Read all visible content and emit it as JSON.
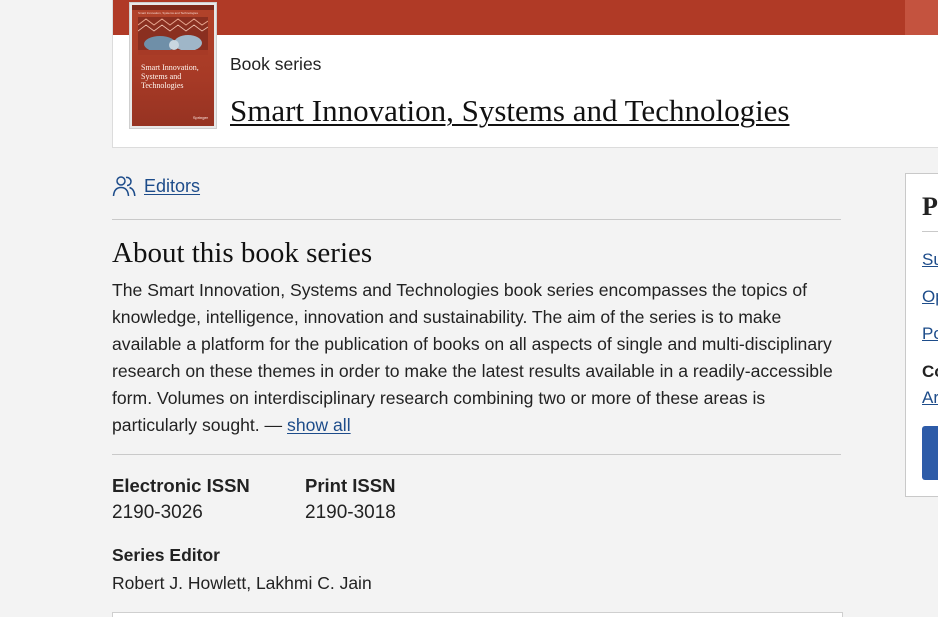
{
  "header": {
    "kicker": "Book series",
    "title": "Smart Innovation, Systems and Technologies",
    "cover": {
      "series_line": "Smart Innovation, Systems and Technologies",
      "title": "Smart Innovation, Systems and Technologies",
      "publisher": "Springer",
      "icon": "book-cover-image"
    },
    "band_color": "#b03a26"
  },
  "editors_link": {
    "label": "Editors",
    "icon": "people-icon"
  },
  "about": {
    "heading": "About this book series",
    "text": "The Smart Innovation, Systems and Technologies book series encompasses the topics of knowledge, intelligence, innovation and sustainability. The aim of the series is to make available a platform for the publication of books on all aspects of single and multi-disciplinary research on these themes in order to make the latest results available in a readily-accessible form. Volumes on interdisciplinary research combining two or more of these areas is particularly sought. —",
    "show_all": "show all"
  },
  "issn": {
    "electronic_label": "Electronic ISSN",
    "electronic_value": "2190-3026",
    "print_label": "Print ISSN",
    "print_value": "2190-3018"
  },
  "series_editor": {
    "label": "Series Editor",
    "value": "Robert J. Howlett, Lakhmi C. Jain"
  },
  "sidebar": {
    "title": "P",
    "links": [
      "Su",
      "Op",
      "Po"
    ],
    "subhead": "Co",
    "sublink": "Ar",
    "button_color": "#2d5ba8"
  },
  "colors": {
    "link": "#1d4c8a",
    "accent": "#b03a26"
  }
}
